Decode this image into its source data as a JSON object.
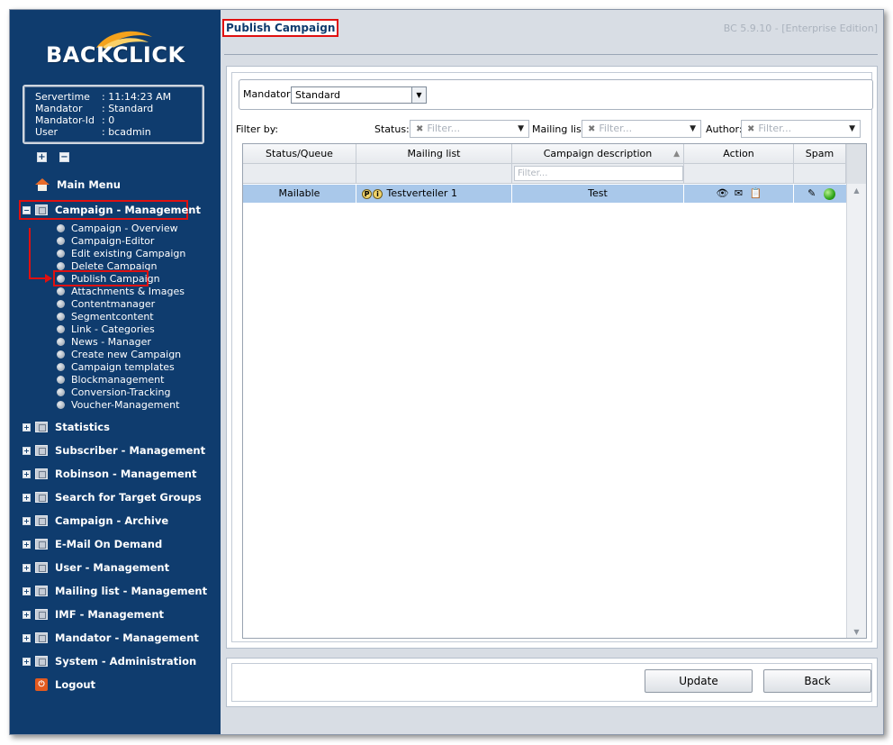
{
  "app": {
    "logo_text": "BACKCLICK",
    "version": "BC 5.9.10 - [Enterprise Edition]",
    "page_title": "Publish Campaign"
  },
  "info": [
    {
      "key": "Servertime",
      "value": ": 11:14:23 AM"
    },
    {
      "key": "Mandator",
      "value": ": Standard"
    },
    {
      "key": "Mandator-Id",
      "value": ": 0"
    },
    {
      "key": "User",
      "value": ": bcadmin"
    }
  ],
  "nav": {
    "main_menu": "Main Menu",
    "campaign_management": "Campaign - Management",
    "campaign_sub": [
      "Campaign - Overview",
      "Campaign-Editor",
      "Edit existing Campaign",
      "Delete Campaign",
      "Publish Campaign",
      "Attachments & Images",
      "Contentmanager",
      "Segmentcontent",
      "Link - Categories",
      "News - Manager",
      "Create new Campaign",
      "Campaign templates",
      "Blockmanagement",
      "Conversion-Tracking",
      "Voucher-Management"
    ],
    "sections": [
      "Statistics",
      "Subscriber - Management",
      "Robinson - Management",
      "Search for Target Groups",
      "Campaign - Archive",
      "E-Mail On Demand",
      "User - Management",
      "Mailing list - Management",
      "IMF - Management",
      "Mandator - Management",
      "System - Administration"
    ],
    "logout": "Logout"
  },
  "mandator": {
    "label": "Mandator:",
    "value": "Standard"
  },
  "filters": {
    "filter_by": "Filter by:",
    "status_label": "Status:",
    "mailing_label": "Mailing list:",
    "author_label": "Author:",
    "placeholder": "Filter..."
  },
  "grid": {
    "columns": [
      "Status/Queue",
      "Mailing list",
      "Campaign description",
      "Action",
      "Spam"
    ],
    "desc_filter_placeholder": "Filter...",
    "rows": [
      {
        "status": "Mailable",
        "mailing_list": "Testverteiler 1",
        "description": "Test"
      }
    ]
  },
  "buttons": {
    "update": "Update",
    "back": "Back"
  },
  "colors": {
    "sidebar_bg": "#0f3c6e",
    "highlight": "#e01010",
    "selected_row": "#a9c8ea",
    "spam_ok": "#2fa51a"
  }
}
